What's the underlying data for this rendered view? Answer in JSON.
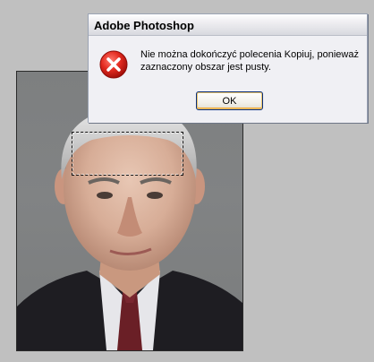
{
  "dialog": {
    "title": "Adobe Photoshop",
    "message": "Nie można dokończyć polecenia Kopiuj, ponieważ zaznaczony obszar jest pusty.",
    "ok_label": "OK",
    "icon": "error-icon"
  },
  "colors": {
    "workspace_bg": "#c0c0c0",
    "dialog_bg": "#f0f0f4",
    "error_red": "#d42020",
    "button_focus": "#f0a83a"
  }
}
